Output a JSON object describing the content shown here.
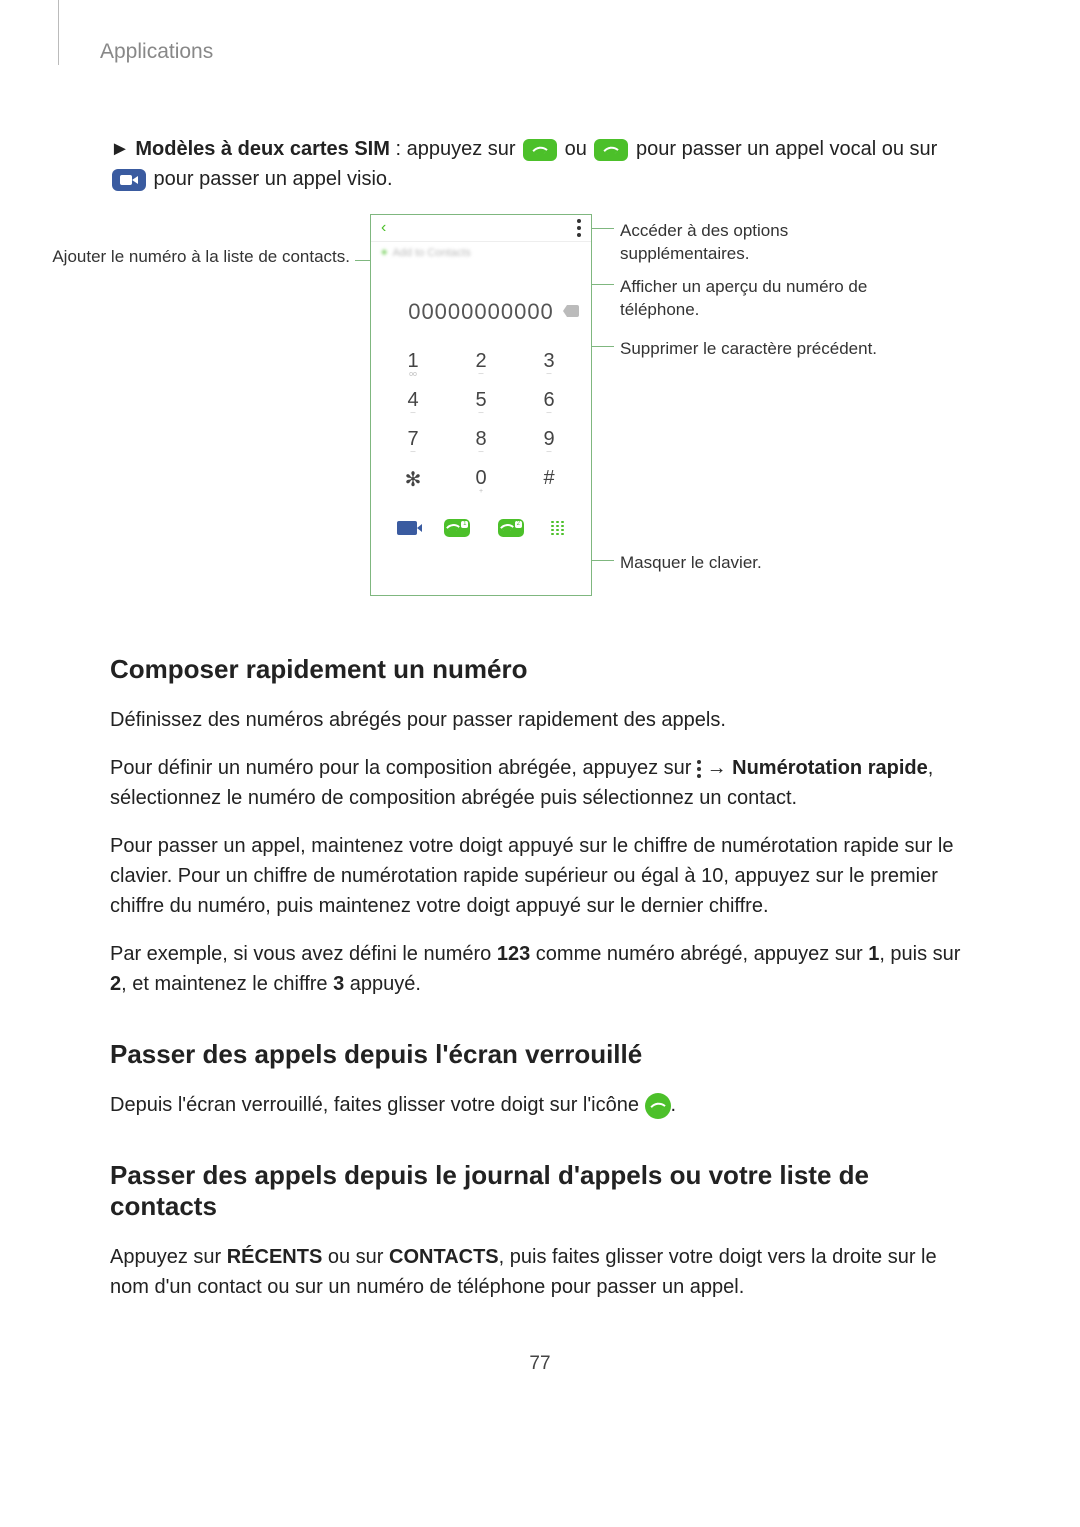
{
  "header": "Applications",
  "page_number": "77",
  "intro": {
    "prefix": "► ",
    "bold1": "Modèles à deux cartes SIM",
    "t1": " : appuyez sur ",
    "t2": " ou ",
    "t3": " pour passer un appel vocal ou sur ",
    "t4": " pour passer un appel visio."
  },
  "figure": {
    "phone_number": "00000000000",
    "add_blur": "Add to Contacts",
    "keys": [
      [
        "1",
        "2",
        "3"
      ],
      [
        "4",
        "5",
        "6"
      ],
      [
        "7",
        "8",
        "9"
      ],
      [
        "✻",
        "0",
        "#"
      ]
    ],
    "callouts": {
      "left1": "Ajouter le numéro à la liste de contacts.",
      "right1": "Accéder à des options supplémentaires.",
      "right2": "Afficher un aperçu du numéro de téléphone.",
      "right3": "Supprimer le caractère précédent.",
      "right4": "Masquer le clavier."
    }
  },
  "s1": {
    "heading": "Composer rapidement un numéro",
    "p1": "Définissez des numéros abrégés pour passer rapidement des appels.",
    "p2a": "Pour définir un numéro pour la composition abrégée, appuyez sur ",
    "p2b": " → ",
    "p2bold": "Numérotation rapide",
    "p2c": ", sélectionnez le numéro de composition abrégée puis sélectionnez un contact.",
    "p3": "Pour passer un appel, maintenez votre doigt appuyé sur le chiffre de numérotation rapide sur le clavier. Pour un chiffre de numérotation rapide supérieur ou égal à 10, appuyez sur le premier chiffre du numéro, puis maintenez votre doigt appuyé sur le dernier chiffre.",
    "p4a": "Par exemple, si vous avez défini le numéro ",
    "p4b1": "123",
    "p4b": " comme numéro abrégé, appuyez sur ",
    "p4b2": "1",
    "p4c": ", puis sur ",
    "p4b3": "2",
    "p4d": ", et maintenez le chiffre ",
    "p4b4": "3",
    "p4e": " appuyé."
  },
  "s2": {
    "heading": "Passer des appels depuis l'écran verrouillé",
    "p1a": "Depuis l'écran verrouillé, faites glisser votre doigt sur l'icône ",
    "p1b": "."
  },
  "s3": {
    "heading": "Passer des appels depuis le journal d'appels ou votre liste de contacts",
    "p1a": "Appuyez sur ",
    "p1b1": "RÉCENTS",
    "p1b": " ou sur ",
    "p1b2": "CONTACTS",
    "p1c": ", puis faites glisser votre doigt vers la droite sur le nom d'un contact ou sur un numéro de téléphone pour passer un appel."
  }
}
